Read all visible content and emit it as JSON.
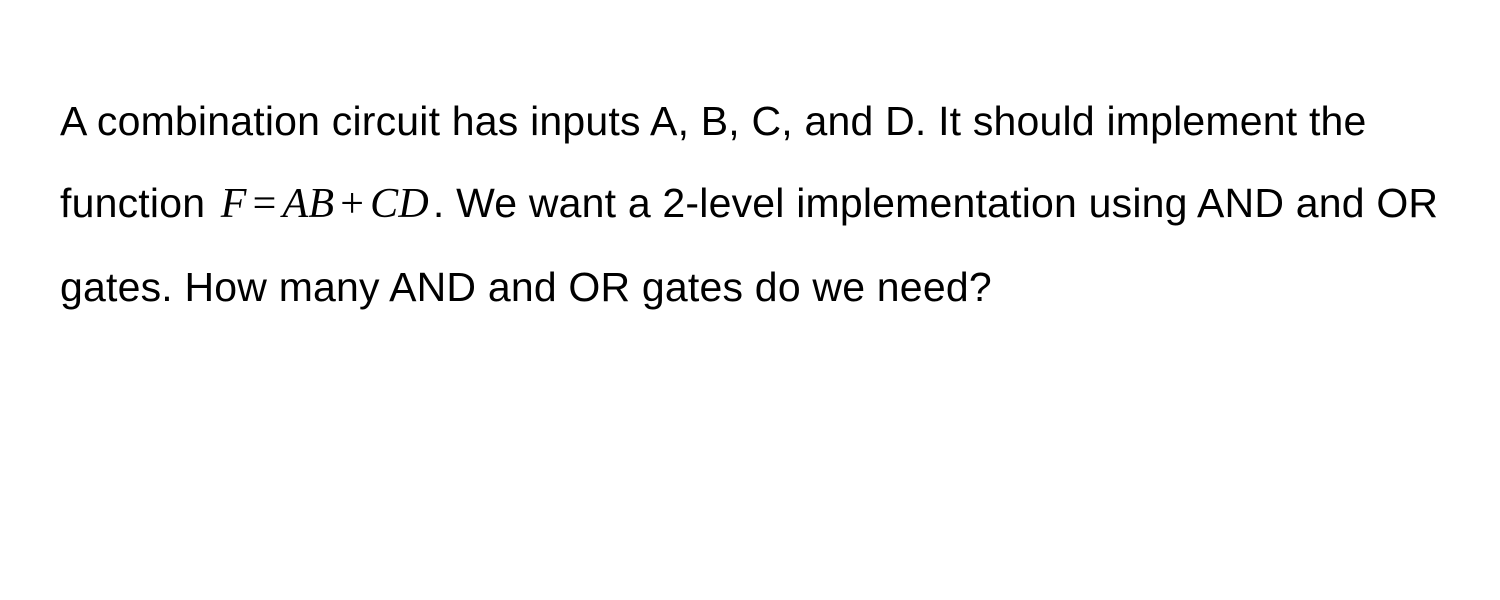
{
  "question": {
    "part1": "A combination circuit has inputs A, B, C, and D. It should implement the function ",
    "formula": {
      "lhs": "F",
      "eq": "=",
      "rhs1": "AB",
      "plus": "+",
      "rhs2": "CD"
    },
    "part2": ". We want a 2-level implementation using AND and OR gates. How many AND and OR gates do we need?"
  }
}
